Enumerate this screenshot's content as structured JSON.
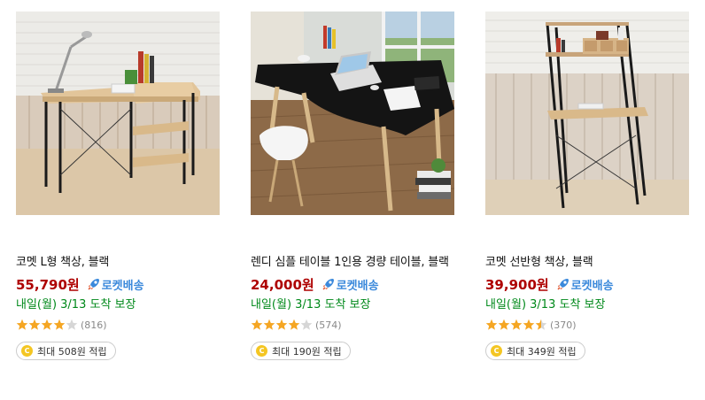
{
  "products": [
    {
      "title": "코멧 L형 책상, 블랙",
      "price": "55,790원",
      "badge": "로켓배송",
      "delivery": "내일(월) 3/13 도착 보장",
      "rating": 4.0,
      "review_count": "(816)",
      "reward": "최대 508원 적립"
    },
    {
      "title": "렌디 심플 테이블 1인용 경량 테이블, 블랙",
      "price": "24,000원",
      "badge": "로켓배송",
      "delivery": "내일(월) 3/13 도착 보장",
      "rating": 4.0,
      "review_count": "(574)",
      "reward": "최대 190원 적립"
    },
    {
      "title": "코멧 선반형 책상, 블랙",
      "price": "39,900원",
      "badge": "로켓배송",
      "delivery": "내일(월) 3/13 도착 보장",
      "rating": 4.5,
      "review_count": "(370)",
      "reward": "최대 349원 적립"
    }
  ],
  "colors": {
    "price": "#ae0000",
    "rocket": "#3b89db",
    "delivery": "#00891a",
    "star": "#f5a623",
    "coin": "#f4c623"
  },
  "icons": {
    "rocket": "rocket-icon",
    "star": "star-icon",
    "coin": "cash-coin-icon"
  },
  "coin_glyph": "C"
}
